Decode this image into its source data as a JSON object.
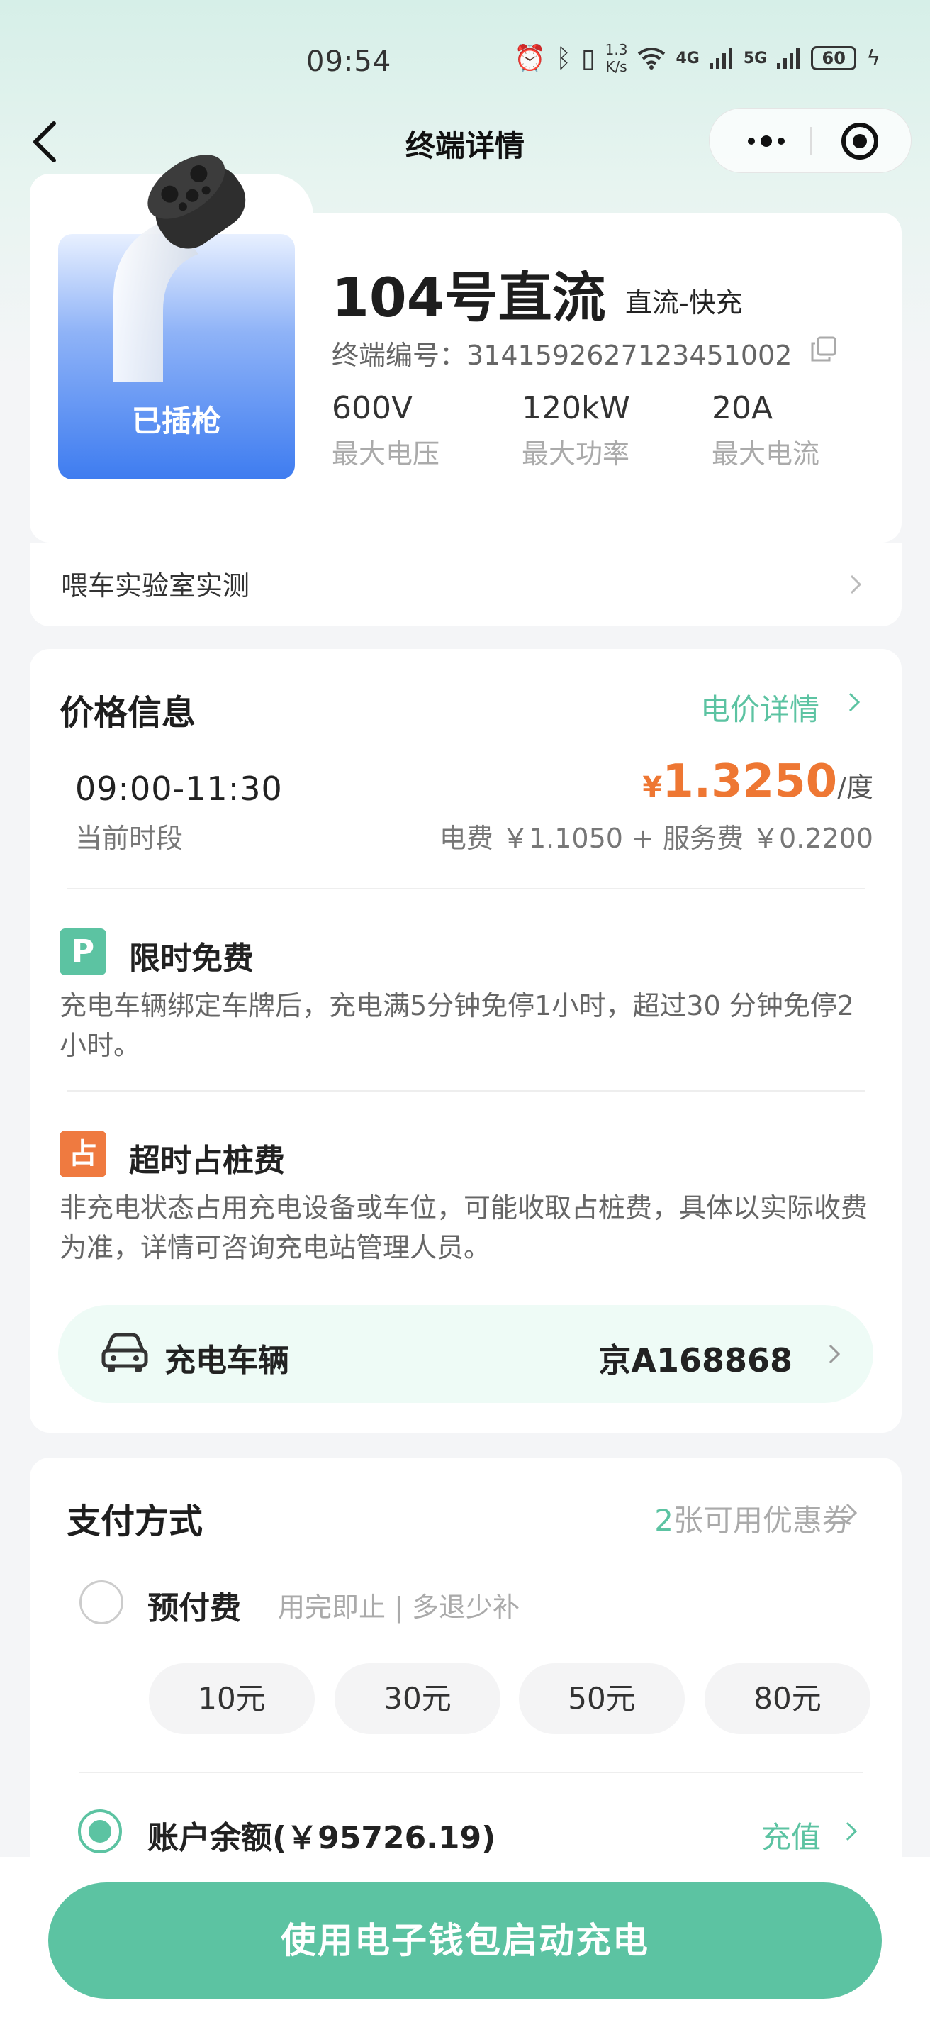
{
  "status_bar": {
    "time": "09:54",
    "net_speed_value": "1.3",
    "net_speed_unit": "K/s",
    "signal_4g": "4G",
    "signal_5g": "5G",
    "battery": "60"
  },
  "nav": {
    "title": "终端详情"
  },
  "terminal": {
    "plug_status": "已插枪",
    "name": "104号直流",
    "type": "直流-快充",
    "code_label": "终端编号：",
    "code": "3141592627123451002",
    "specs": [
      {
        "value": "600V",
        "label": "最大电压"
      },
      {
        "value": "120kW",
        "label": "最大功率"
      },
      {
        "value": "20A",
        "label": "最大电流"
      }
    ],
    "lab_row": "喂车实验室实测"
  },
  "price": {
    "title": "价格信息",
    "detail_link": "电价详情",
    "period_time": "09:00-11:30",
    "period_label": "当前时段",
    "currency": "¥",
    "amount": "1.3250",
    "unit": "/度",
    "breakdown": "电费 ￥1.1050 + 服务费 ￥0.2200",
    "free_badge": "P",
    "free_title": "限时免费",
    "free_desc": "充电车辆绑定车牌后，充电满5分钟免停1小时，超过30 分钟免停2小时。",
    "occupy_badge": "占",
    "occupy_title": "超时占桩费",
    "occupy_desc": "非充电状态占用充电设备或车位，可能收取占桩费，具体以实际收费为准，详情可咨询充电站管理人员。",
    "vehicle_label": "充电车辆",
    "vehicle_plate": "京A168868"
  },
  "payment": {
    "title": "支付方式",
    "coupon_count": "2",
    "coupon_text": "张可用优惠券",
    "prepay_title": "预付费",
    "prepay_sub": "用完即止 | 多退少补",
    "amounts": [
      "10元",
      "30元",
      "50元",
      "80元"
    ],
    "balance_title": "账户余额(￥95726.19)",
    "recharge": "充值",
    "selected": "balance"
  },
  "action": {
    "start_label": "使用电子钱包启动充电"
  },
  "colors": {
    "accent": "#5cc3a2",
    "price": "#ee7733",
    "plug_blue": "#3e7cf0"
  }
}
